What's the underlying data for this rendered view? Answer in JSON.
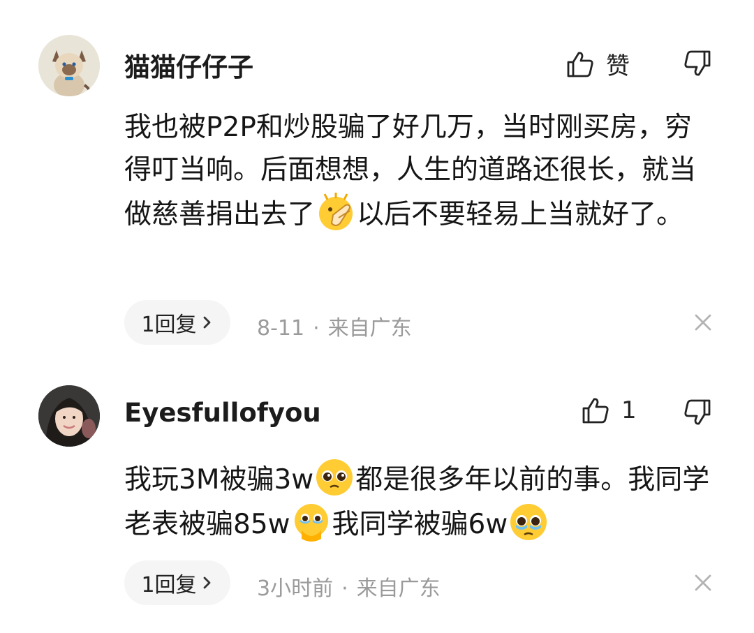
{
  "comments": [
    {
      "username": "猫猫仔仔子",
      "like_label": "赞",
      "text_parts": [
        "我也被P2P和炒股骗了好几万，当时刚买房，穷得叮当响。后面想想，人生的道路还很长，就当做慈善捐出去了",
        "以后不要轻易上当就好了。"
      ],
      "emojis": [
        "clapping-hands-emoji"
      ],
      "reply_label": "1回复",
      "time": "8-11",
      "location": "来自广东"
    },
    {
      "username": "Eyesfullofyou",
      "like_label": "1",
      "text_parts": [
        "我玩3M被骗3w",
        "都是很多年以前的事。我同学老表被骗85w",
        "我同学被骗6w"
      ],
      "emojis": [
        "pleading-face-emoji",
        "face-holding-back-tears-emoji",
        "crying-pleading-face-emoji"
      ],
      "reply_label": "1回复",
      "time": "3小时前",
      "location": "来自广东"
    }
  ],
  "meta_separator": "·",
  "icons": {
    "like": "thumbs-up-outline-icon",
    "dislike": "thumbs-down-outline-icon",
    "close": "close-x-icon",
    "chevron": "chevron-right-icon"
  },
  "colors": {
    "pill_bg": "#f5f5f5",
    "meta_text": "#9a9a9a",
    "emoji_yellow": "#ffcc33"
  }
}
